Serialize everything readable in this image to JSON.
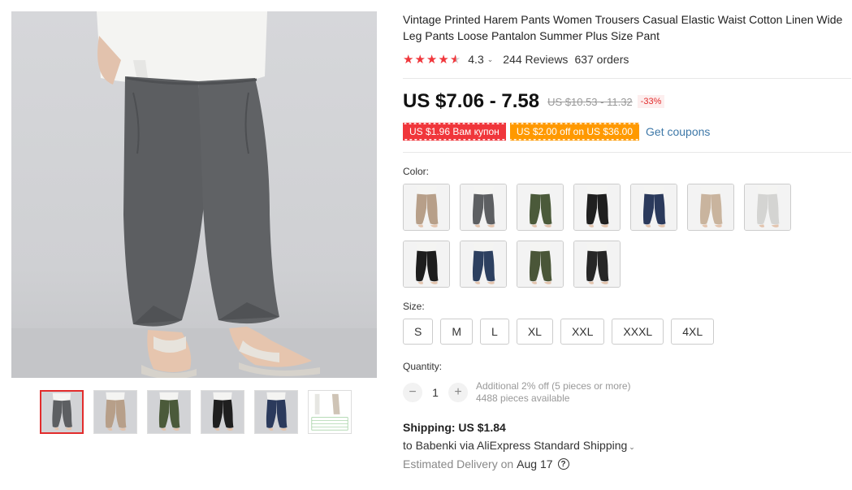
{
  "product": {
    "title": "Vintage Printed Harem Pants Women Trousers Casual Elastic Waist Cotton Linen Wide Leg Pants Loose Pantalon Summer Plus Size Pant",
    "rating": "4.3",
    "rating_stars": 4.3,
    "reviews": "244 Reviews",
    "orders": "637 orders"
  },
  "price": {
    "current": "US $7.06 - 7.58",
    "original": "US $10.53 - 11.32",
    "discount": "-33%"
  },
  "coupons": {
    "coupon1": "US $1.96 Вам купон",
    "coupon2": "US $2.00 off on US $36.00",
    "get_coupons": "Get coupons"
  },
  "color": {
    "label": "Color:",
    "options": [
      {
        "name": "khaki",
        "hex": "#b79f89"
      },
      {
        "name": "gray",
        "hex": "#5d5f62"
      },
      {
        "name": "army green",
        "hex": "#4b5a3a"
      },
      {
        "name": "black",
        "hex": "#1f1f1f"
      },
      {
        "name": "navy",
        "hex": "#2b3a5c"
      },
      {
        "name": "beige",
        "hex": "#c9b49e"
      },
      {
        "name": "light gray",
        "hex": "#d4d4d2"
      },
      {
        "name": "black print",
        "hex": "#1d1d1d"
      },
      {
        "name": "navy print",
        "hex": "#2d4060"
      },
      {
        "name": "green print",
        "hex": "#4a5638"
      },
      {
        "name": "dark print",
        "hex": "#262626"
      }
    ]
  },
  "size": {
    "label": "Size:",
    "options": [
      "S",
      "M",
      "L",
      "XL",
      "XXL",
      "XXXL",
      "4XL"
    ]
  },
  "quantity": {
    "label": "Quantity:",
    "value": "1",
    "minus": "−",
    "plus": "+",
    "discount_note": "Additional 2% off (5 pieces or more)",
    "available": "4488 pieces available"
  },
  "shipping": {
    "cost": "Shipping: US $1.84",
    "via": "to Babenki via AliExpress Standard Shipping",
    "delivery_label": "Estimated Delivery on",
    "delivery_date": "Aug 17",
    "help": "?"
  },
  "gallery": {
    "thumbnails": [
      {
        "name": "gray",
        "hex": "#5d5f62",
        "active": true
      },
      {
        "name": "khaki",
        "hex": "#b79f89",
        "active": false
      },
      {
        "name": "army green",
        "hex": "#4b5a3a",
        "active": false
      },
      {
        "name": "black",
        "hex": "#1f1f1f",
        "active": false
      },
      {
        "name": "navy",
        "hex": "#2b3a5c",
        "active": false
      },
      {
        "name": "size chart",
        "hex": "#cfc4b6",
        "active": false
      }
    ]
  },
  "icons": {
    "star": "star-icon",
    "chevron": "chevron-down-icon",
    "help": "help-circle-icon"
  }
}
